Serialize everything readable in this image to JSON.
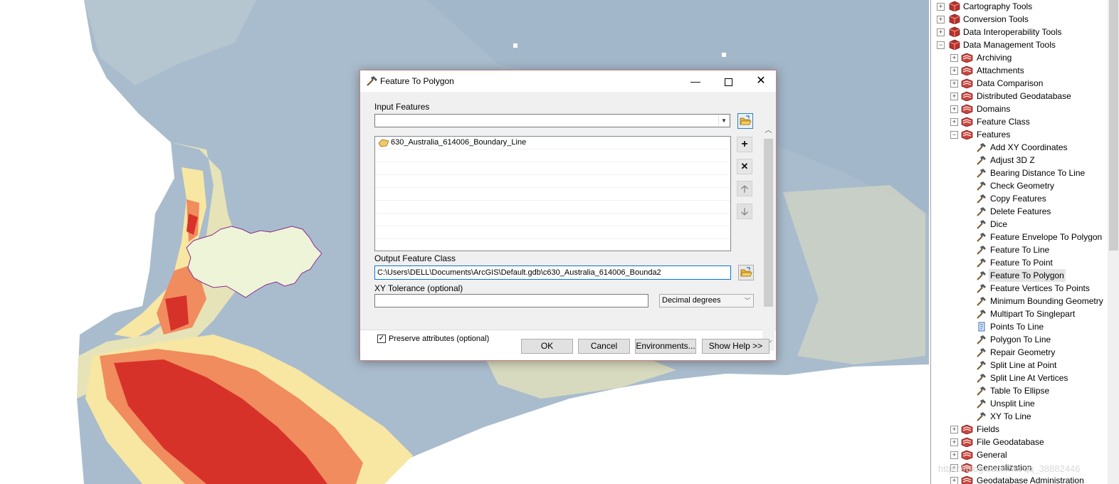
{
  "dialog": {
    "title": "Feature To Polygon",
    "input_label": "Input Features",
    "input_value": "",
    "list_items": [
      "630_Australia_614006_Boundary_Line"
    ],
    "output_label": "Output Feature Class",
    "output_value": "C:\\Users\\DELL\\Documents\\ArcGIS\\Default.gdb\\c630_Australia_614006_Bounda2",
    "xy_label": "XY Tolerance (optional)",
    "xy_value": "",
    "units_value": "Decimal degrees",
    "preserve_label": "Preserve attributes (optional)",
    "preserve_checked": true,
    "buttons": {
      "ok": "OK",
      "cancel": "Cancel",
      "environments": "Environments...",
      "help": "Show Help >>"
    },
    "window_icons": {
      "minimize": "minimize-icon",
      "maximize": "maximize-icon",
      "close": "close-icon"
    },
    "side_icons": [
      "add-icon",
      "remove-icon",
      "move-up-icon",
      "move-down-icon"
    ]
  },
  "toolbox": {
    "top_toolboxes": [
      {
        "label": "Cartography Tools",
        "expanded": false
      },
      {
        "label": "Conversion Tools",
        "expanded": false
      },
      {
        "label": "Data Interoperability Tools",
        "expanded": false
      },
      {
        "label": "Data Management Tools",
        "expanded": true
      }
    ],
    "toolsets_before": [
      "Archiving",
      "Attachments",
      "Data Comparison",
      "Distributed Geodatabase",
      "Domains",
      "Feature Class"
    ],
    "open_toolset": "Features",
    "tools": [
      "Add XY Coordinates",
      "Adjust 3D Z",
      "Bearing Distance To Line",
      "Check Geometry",
      "Copy Features",
      "Delete Features",
      "Dice",
      "Feature Envelope To Polygon",
      "Feature To Line",
      "Feature To Point",
      "Feature To Polygon",
      "Feature Vertices To Points",
      "Minimum Bounding Geometry",
      "Multipart To Singlepart",
      "Points To Line",
      "Polygon To Line",
      "Repair Geometry",
      "Split Line at Point",
      "Split Line At Vertices",
      "Table To Ellipse",
      "Unsplit Line",
      "XY To Line"
    ],
    "selected_tool": "Feature To Polygon",
    "toolsets_after": [
      "Fields",
      "File Geodatabase",
      "General",
      "Generalization",
      "Geodatabase Administration"
    ]
  },
  "watermark": "https://blog.csdn.net/qq_38882446",
  "colors": {
    "map_blue": "#a9bccd",
    "map_pale": "#e6e3b8",
    "map_yellow": "#f7e7a3",
    "map_orange": "#f08c5e",
    "map_red": "#d7322a",
    "polygon_fill": "#eef4d8",
    "polygon_outline": "#8b2a8f",
    "toolbox_red": "#b9302b",
    "selection": "#0078d7"
  }
}
